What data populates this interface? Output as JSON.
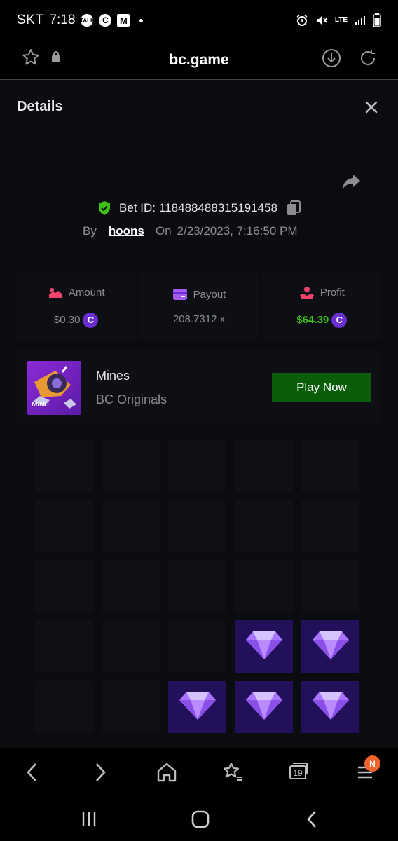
{
  "status_bar": {
    "carrier": "SKT",
    "time": "7:18",
    "notif_talk": "TALK",
    "notif_c": "C",
    "notif_m": "M",
    "network": "LTE"
  },
  "browser": {
    "url": "bc.game",
    "tab_count": "19",
    "menu_badge": "N"
  },
  "details": {
    "title": "Details",
    "bet_id_label": "Bet ID:",
    "bet_id": "118488488315191458",
    "by_label": "By",
    "user": "hoons",
    "on_label": "On",
    "date": "2/23/2023, 7:16:50 PM",
    "stats": [
      {
        "label": "Amount",
        "value": "$0.30",
        "coin": true,
        "icon": "amount-icon"
      },
      {
        "label": "Payout",
        "value": "208.7312 x",
        "coin": false,
        "icon": "payout-icon"
      },
      {
        "label": "Profit",
        "value": "$64.39",
        "coin": true,
        "icon": "profit-icon"
      }
    ],
    "coin_symbol": "C"
  },
  "game": {
    "name": "Mines",
    "provider": "BC Originals",
    "thumb_label": "MINE",
    "play_label": "Play Now"
  },
  "colors": {
    "profit_green": "#3bc117",
    "play_button": "#0a5e0a",
    "gem_tile": "#22105a",
    "coin": "#6a2fd0"
  }
}
